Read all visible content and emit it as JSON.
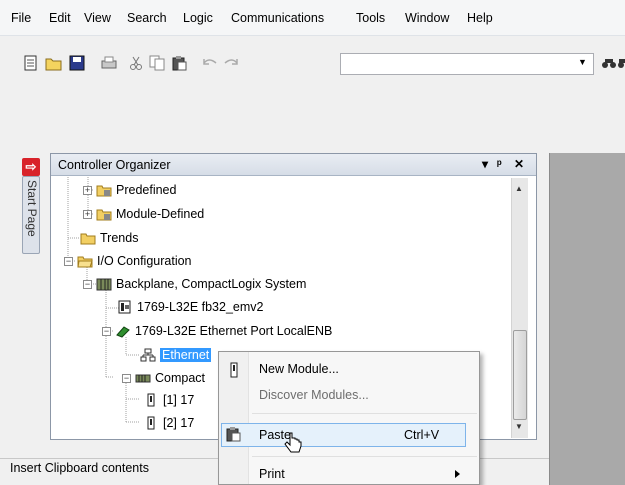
{
  "menubar": {
    "items": [
      "File",
      "Edit",
      "View",
      "Search",
      "Logic",
      "Communications",
      "Tools",
      "Window",
      "Help"
    ]
  },
  "toolbar": {
    "icons": [
      "new-icon",
      "open-icon",
      "save-icon",
      "print-icon",
      "cut-icon",
      "copy-icon",
      "paste-icon",
      "undo-icon",
      "redo-icon",
      "find-icon",
      "find-next-icon"
    ],
    "combo_value": ""
  },
  "start_tab": {
    "label": "Start Page"
  },
  "organizer": {
    "title": "Controller Organizer",
    "controls": {
      "dropdown": "▾",
      "pin": "ᵖ",
      "close": "✕"
    }
  },
  "tree": {
    "items": [
      {
        "label": "Predefined"
      },
      {
        "label": "Module-Defined"
      },
      {
        "label": "Trends"
      },
      {
        "label": "I/O Configuration"
      },
      {
        "label": "Backplane, CompactLogix System"
      },
      {
        "label": "1769-L32E fb32_emv2"
      },
      {
        "label": "1769-L32E Ethernet Port LocalENB"
      },
      {
        "label": "Ethernet"
      },
      {
        "label": "Compact"
      },
      {
        "label": "[1] 17"
      },
      {
        "label": "[2] 17"
      }
    ]
  },
  "context_menu": {
    "items": [
      {
        "label": "New Module..."
      },
      {
        "label": "Discover Modules..."
      },
      {
        "label": "Paste",
        "shortcut": "Ctrl+V"
      },
      {
        "label": "Print"
      }
    ]
  },
  "status": {
    "text": "Insert Clipboard contents"
  },
  "colors": {
    "selection": "#3399ff",
    "hover": "#e5f1fb",
    "panel_gray": "#a9a9a9"
  }
}
